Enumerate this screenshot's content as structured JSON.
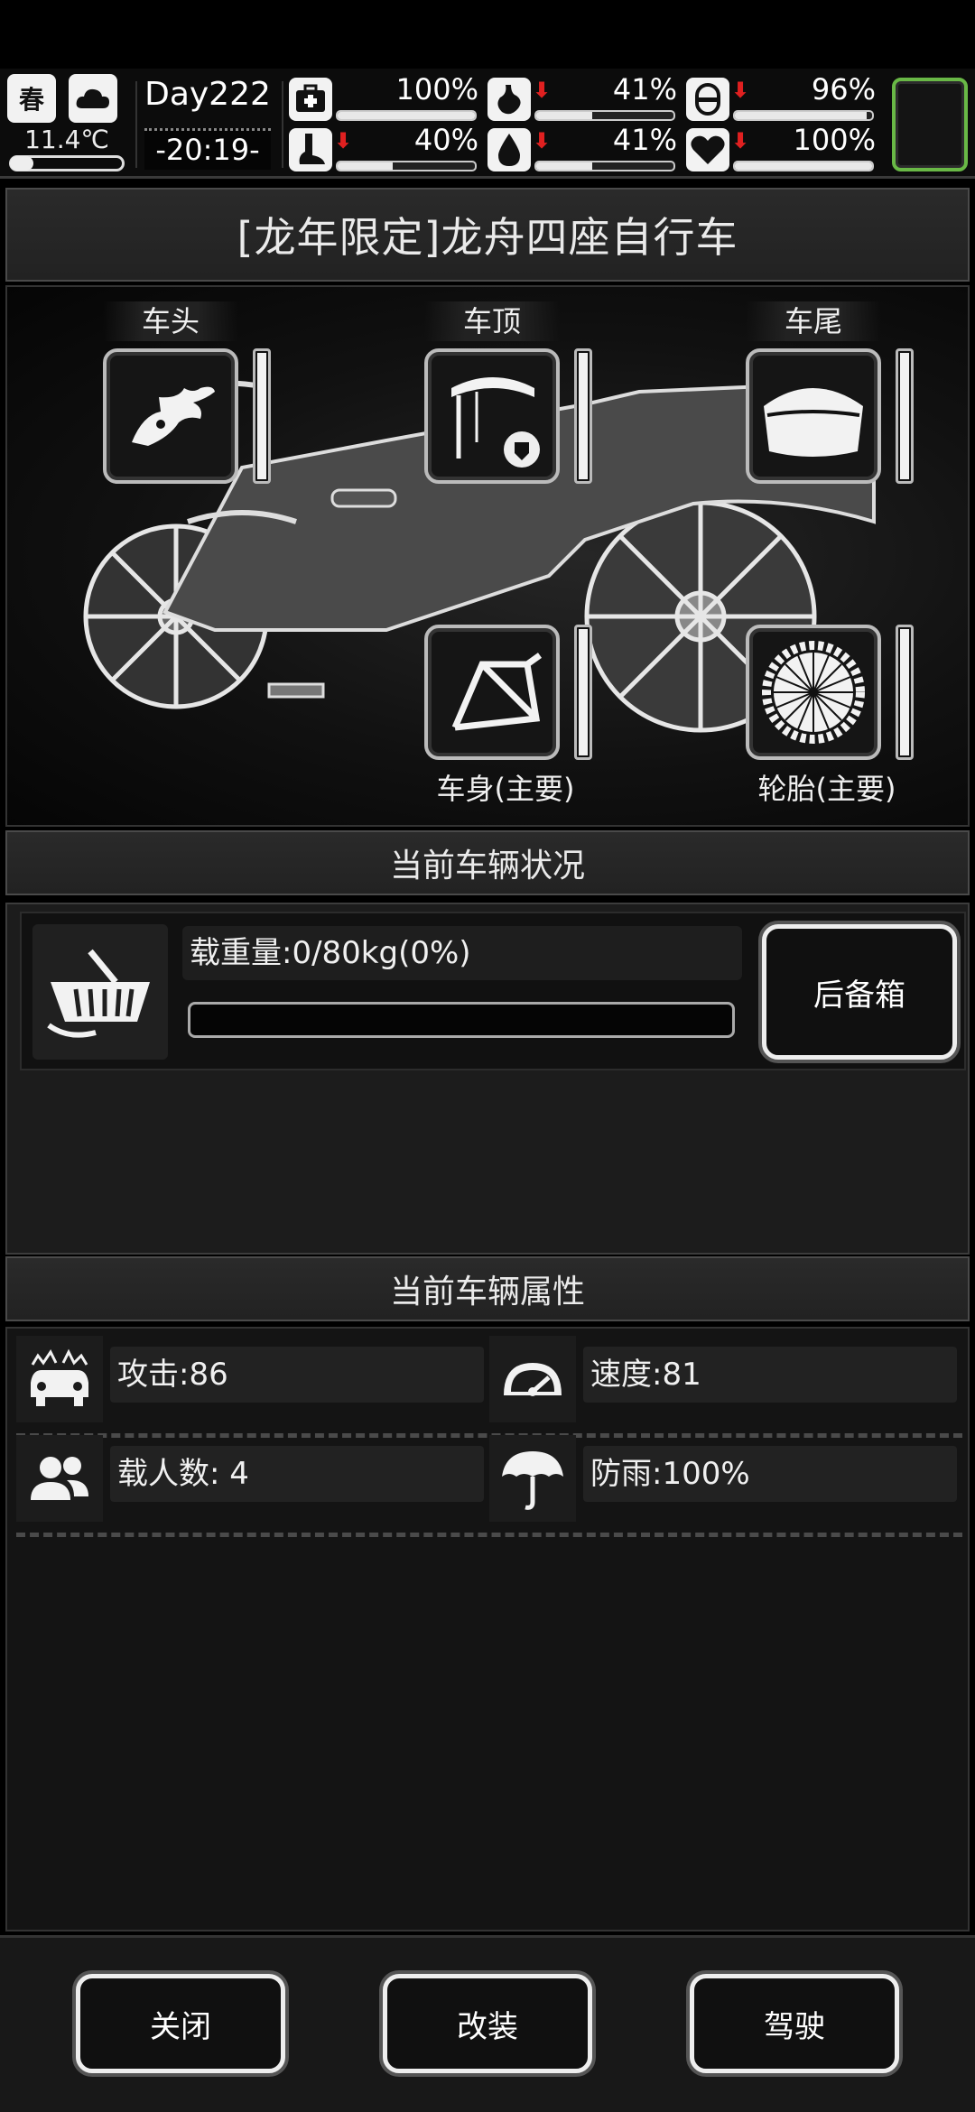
{
  "status": {
    "season": "春",
    "temperature": "11.4℃",
    "day": "Day222",
    "time": "-20:19-",
    "stats": [
      {
        "icon": "medkit-icon",
        "value": "100%",
        "level": 1.0,
        "falling": false
      },
      {
        "icon": "stomach-icon",
        "value": "41%",
        "level": 0.41,
        "falling": true
      },
      {
        "icon": "bandage-icon",
        "value": "96%",
        "level": 0.96,
        "falling": true
      },
      {
        "icon": "foot-icon",
        "value": "40%",
        "level": 0.4,
        "falling": true
      },
      {
        "icon": "water-drop-icon",
        "value": "41%",
        "level": 0.41,
        "falling": true
      },
      {
        "icon": "heart-icon",
        "value": "100%",
        "level": 1.0,
        "falling": true
      }
    ]
  },
  "vehicle": {
    "title": "[龙年限定]龙舟四座自行车",
    "slots": {
      "head": {
        "label": "车头",
        "icon": "dragon-head-icon"
      },
      "roof": {
        "label": "车顶",
        "icon": "canopy-icon"
      },
      "tail": {
        "label": "车尾",
        "icon": "trunk-box-icon"
      },
      "body": {
        "label": "车身(主要)",
        "icon": "bike-frame-icon"
      },
      "tire": {
        "label": "轮胎(主要)",
        "icon": "wheel-icon"
      }
    }
  },
  "status_section": {
    "title": "当前车辆状况",
    "load_label": "载重量:0/80kg(0%)",
    "load_fraction": 0,
    "trunk_button": "后备箱"
  },
  "attr_section": {
    "title": "当前车辆属性",
    "attack": "攻击:86",
    "speed": "速度:81",
    "passengers": "载人数: 4",
    "rain": "防雨:100%"
  },
  "footer": {
    "close": "关闭",
    "modify": "改装",
    "drive": "驾驶"
  },
  "colors": {
    "accent_green": "#69b846",
    "warning_red": "#e02020"
  }
}
